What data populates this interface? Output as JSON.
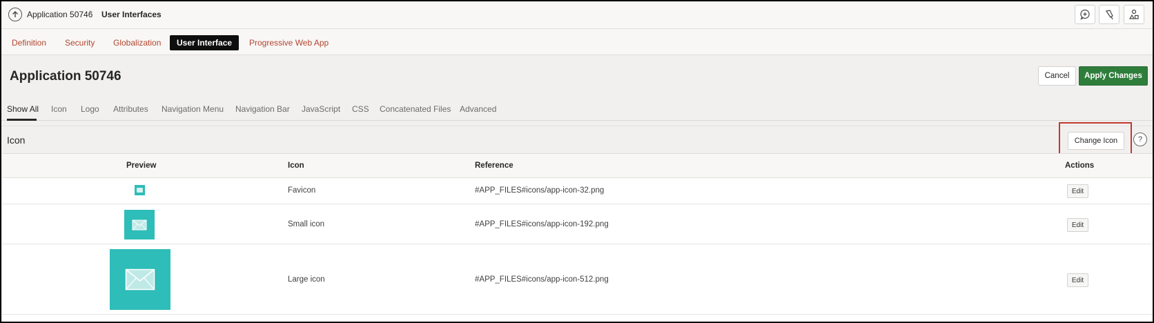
{
  "breadcrumb": {
    "application": "Application 50746",
    "separator": "\\",
    "current": "User Interfaces"
  },
  "toolbar": {
    "buttons": [
      "comment-add-icon",
      "pin-icon",
      "shared-components-icon"
    ]
  },
  "tabs": [
    {
      "label": "Definition",
      "active": false
    },
    {
      "label": "Security",
      "active": false
    },
    {
      "label": "Globalization",
      "active": false
    },
    {
      "label": "User Interface",
      "active": true
    },
    {
      "label": "Progressive Web App",
      "active": false
    }
  ],
  "page": {
    "title": "Application 50746",
    "cancel_label": "Cancel",
    "apply_label": "Apply Changes"
  },
  "subtabs": [
    {
      "label": "Show All",
      "active": true
    },
    {
      "label": "Icon",
      "active": false
    },
    {
      "label": "Logo",
      "active": false
    },
    {
      "label": "Attributes",
      "active": false
    },
    {
      "label": "Navigation Menu",
      "active": false
    },
    {
      "label": "Navigation Bar",
      "active": false
    },
    {
      "label": "JavaScript",
      "active": false
    },
    {
      "label": "CSS",
      "active": false
    },
    {
      "label": "Concatenated Files",
      "active": false
    },
    {
      "label": "Advanced",
      "active": false
    }
  ],
  "region": {
    "title": "Icon",
    "change_icon_label": "Change Icon",
    "help_label": "?"
  },
  "table": {
    "columns": [
      "Preview",
      "Icon",
      "Reference",
      "Actions"
    ],
    "rows": [
      {
        "icon": "Favicon",
        "reference": "#APP_FILES#icons/app-icon-32.png",
        "action": "Edit"
      },
      {
        "icon": "Small icon",
        "reference": "#APP_FILES#icons/app-icon-192.png",
        "action": "Edit"
      },
      {
        "icon": "Large icon",
        "reference": "#APP_FILES#icons/app-icon-512.png",
        "action": "Edit"
      }
    ]
  },
  "colors": {
    "tab_text": "#b2452d",
    "apply_button": "#2f7d3b",
    "icon_teal": "#2ebdb8",
    "highlight": "#c0392b"
  }
}
